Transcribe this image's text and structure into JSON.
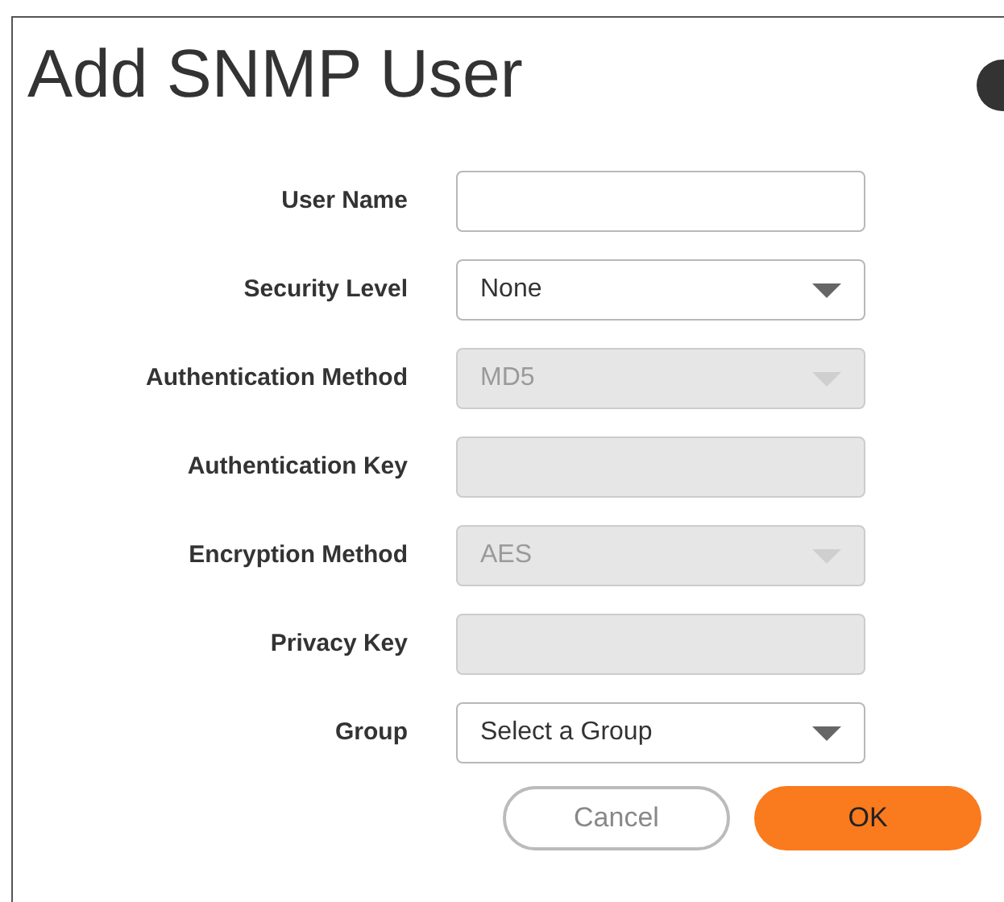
{
  "dialog": {
    "title": "Add SNMP User"
  },
  "fields": [
    {
      "label": "User Name",
      "kind": "text",
      "disabled": false
    },
    {
      "label": "Security Level",
      "kind": "select",
      "disabled": false,
      "value": "None"
    },
    {
      "label": "Authentication Method",
      "kind": "select",
      "disabled": true,
      "value": "MD5"
    },
    {
      "label": "Authentication Key",
      "kind": "text",
      "disabled": true
    },
    {
      "label": "Encryption Method",
      "kind": "select",
      "disabled": true,
      "value": "AES"
    },
    {
      "label": "Privacy Key",
      "kind": "text",
      "disabled": true
    },
    {
      "label": "Group",
      "kind": "select",
      "disabled": false,
      "value": "Select a Group"
    }
  ],
  "buttons": [
    {
      "label": "Cancel",
      "kind": "secondary"
    },
    {
      "label": "OK",
      "kind": "primary"
    }
  ]
}
